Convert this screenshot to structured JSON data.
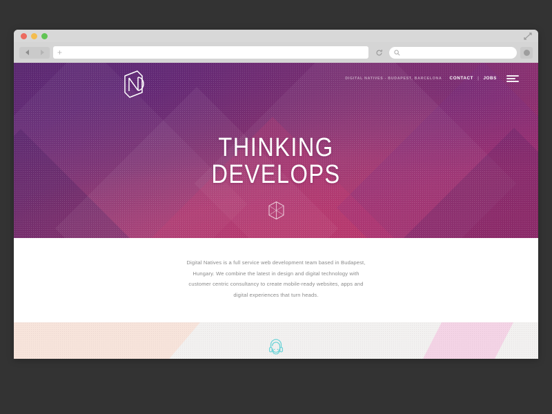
{
  "window": {
    "traffic_lights": [
      "close",
      "minimize",
      "maximize"
    ],
    "toolbar": {
      "back_label": "",
      "forward_label": "",
      "new_tab_label": "+",
      "url_value": "",
      "url_placeholder": "",
      "reload_label": "",
      "search_value": "",
      "search_placeholder": "",
      "profile_label": ""
    }
  },
  "site": {
    "nav": {
      "logo_alt": "Digital Natives logo",
      "tagline": "DIGITAL NATIVES - BUDAPEST, BARCELONA",
      "links": [
        {
          "label": "CONTACT"
        },
        {
          "label": "JOBS"
        }
      ],
      "separator": "|",
      "menu_label": ""
    },
    "hero": {
      "headline_line1": "THINKING",
      "headline_line2": "DEVELOPS",
      "scroll_icon": "hexagon-cube-icon"
    },
    "intro": {
      "paragraph": "Digital Natives is a full service web development team based in Budapest, Hungary. We combine the latest in design and digital technology with customer centric consultancy to create mobile-ready websites, apps and digital experiences that turn heads."
    },
    "band": {
      "icon": "headphones-face-icon"
    }
  },
  "colors": {
    "page_background": "#333333",
    "chrome": "#d5d5d5",
    "hero_purple": "#5b2a6e",
    "hero_magenta": "#ad2f63",
    "band_peach": "#f7e4db",
    "band_pink": "#f4d4e6",
    "band_gray": "#f2f1f0",
    "accent_cyan": "#6fd4d8",
    "body_text": "#8a8a8a"
  }
}
